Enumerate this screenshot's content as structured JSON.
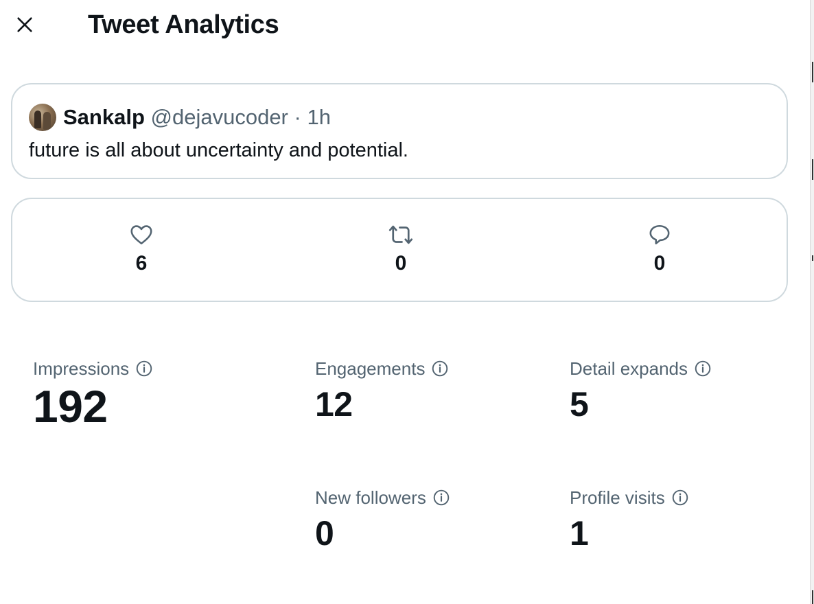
{
  "header": {
    "title": "Tweet Analytics",
    "close_icon": "close-icon"
  },
  "tweet": {
    "author_name": "Sankalp",
    "handle": "@dejavucoder",
    "separator": "·",
    "time": "1h",
    "text": "future is all about uncertainty and potential."
  },
  "engagement_counts": {
    "likes": {
      "icon": "heart-icon",
      "count": "6"
    },
    "retweets": {
      "icon": "retweet-icon",
      "count": "0"
    },
    "replies": {
      "icon": "reply-icon",
      "count": "0"
    }
  },
  "metrics": {
    "impressions": {
      "label": "Impressions",
      "value": "192"
    },
    "engagements": {
      "label": "Engagements",
      "value": "12"
    },
    "detail_expands": {
      "label": "Detail expands",
      "value": "5"
    },
    "new_followers": {
      "label": "New followers",
      "value": "0"
    },
    "profile_visits": {
      "label": "Profile visits",
      "value": "1"
    }
  },
  "colors": {
    "text_primary": "#0f1419",
    "text_secondary": "#536471",
    "border": "#cfd9de"
  }
}
